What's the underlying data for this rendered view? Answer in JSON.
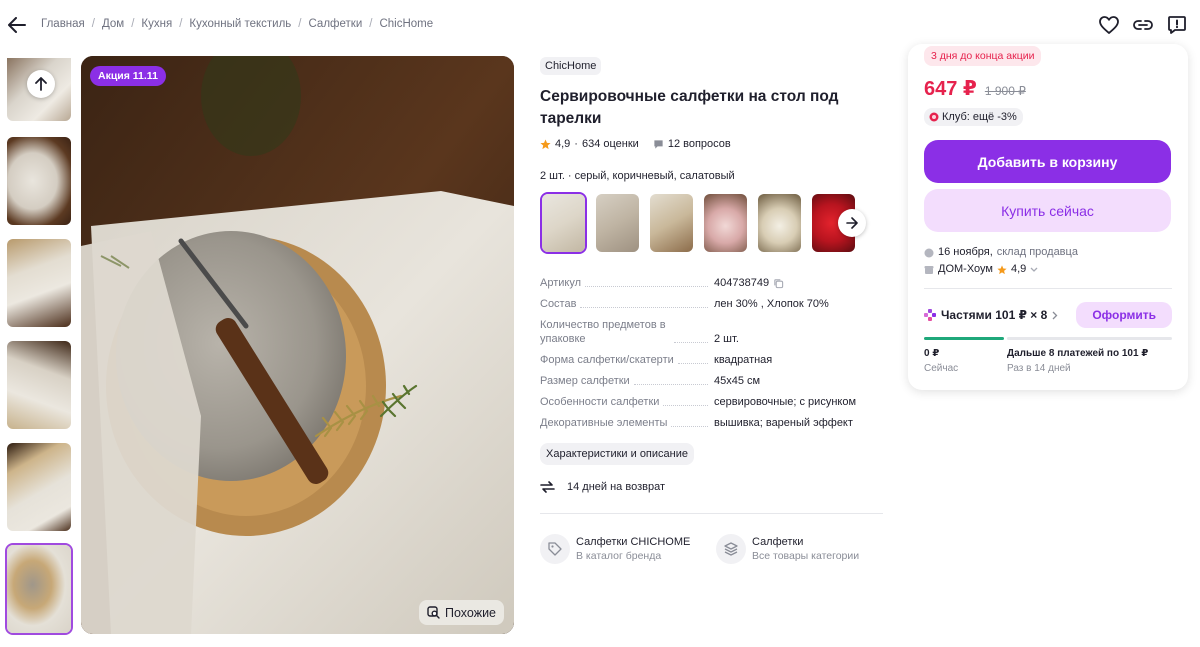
{
  "breadcrumb": [
    "Главная",
    "Дом",
    "Кухня",
    "Кухонный текстиль",
    "Салфетки",
    "ChicHome"
  ],
  "badges": {
    "promo": "Акция 11.11"
  },
  "main_image": {
    "similar_label": "Похожие"
  },
  "product": {
    "brand": "ChicHome",
    "title": "Сервировочные салфетки на стол под тарелки",
    "rating": "4,9",
    "reviews": "634 оценки",
    "questions": "12 вопросов",
    "variant_label": "2 шт. · серый, коричневый, салатовый"
  },
  "specs": [
    {
      "key": "Артикул",
      "value": "404738749"
    },
    {
      "key": "Состав",
      "value": "лен 30% , Хлопок 70%"
    },
    {
      "key": "Количество предметов в упаковке",
      "value": "2 шт."
    },
    {
      "key": "Форма салфетки/скатерти",
      "value": "квадратная"
    },
    {
      "key": "Размер салфетки",
      "value": "45x45 см"
    },
    {
      "key": "Особенности салфетки",
      "value": "сервировочные; с рисунком"
    },
    {
      "key": "Декоративные элементы",
      "value": "вышивка; вареный эффект"
    }
  ],
  "description_button": "Характеристики и описание",
  "return_policy": "14 дней на возврат",
  "links": [
    {
      "title": "Салфетки CHICHOME",
      "subtitle": "В каталог бренда"
    },
    {
      "title": "Салфетки",
      "subtitle": "Все товары категории"
    }
  ],
  "panel": {
    "deadline": "3 дня до конца акции",
    "price": "647 ₽",
    "old_price": "1 900 ₽",
    "club": "Клуб: ещё -3%",
    "add_to_cart": "Добавить в корзину",
    "buy_now": "Купить сейчас",
    "delivery_date": "16 ноября,",
    "delivery_source": "склад продавца",
    "seller": "ДОМ-Хоум",
    "seller_rating": "4,9",
    "installments_label": "Частями 101 ₽ × 8",
    "installments_button": "Оформить",
    "installments_progress": 0.25,
    "now_amount": "0 ₽",
    "now_label": "Сейчас",
    "later_amount": "Дальше 8 платежей по 101 ₽",
    "later_label": "Раз в 14 дней"
  },
  "colors": {
    "accent": "#8b2fe6",
    "price": "#e6224d",
    "progress": "#1fa87a"
  }
}
